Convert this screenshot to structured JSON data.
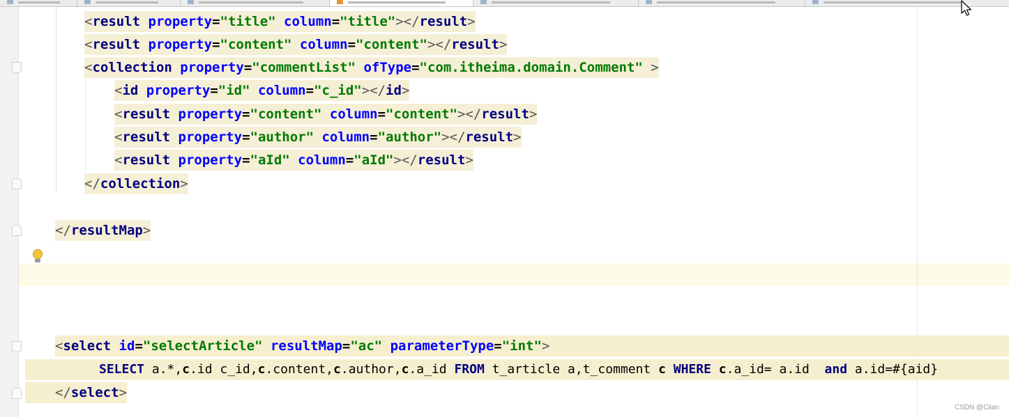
{
  "editor": {
    "tabs": [
      {
        "label": ""
      },
      {
        "label": ""
      },
      {
        "label": ""
      },
      {
        "label": "",
        "active": true
      },
      {
        "label": ""
      },
      {
        "label": ""
      },
      {
        "label": ""
      }
    ],
    "code": {
      "l1": {
        "o": "<",
        "tag": "result",
        "a1": "property",
        "v1": "\"title\"",
        "a2": "column",
        "v2": "\"title\"",
        "c": "></",
        "ct": "result",
        "e": ">"
      },
      "l2": {
        "o": "<",
        "tag": "result",
        "a1": "property",
        "v1": "\"content\"",
        "a2": "column",
        "v2": "\"content\"",
        "c": "></",
        "ct": "result",
        "e": ">"
      },
      "l3": {
        "o": "<",
        "tag": "collection",
        "a1": "property",
        "v1": "\"commentList\"",
        "a2": "ofType",
        "v2": "\"com.itheima.domain.Comment\"",
        "e": ">"
      },
      "l4": {
        "o": "<",
        "tag": "id",
        "a1": "property",
        "v1": "\"id\"",
        "a2": "column",
        "v2": "\"c_id\"",
        "c": "></",
        "ct": "id",
        "e": ">"
      },
      "l5": {
        "o": "<",
        "tag": "result",
        "a1": "property",
        "v1": "\"content\"",
        "a2": "column",
        "v2": "\"content\"",
        "c": "></",
        "ct": "result",
        "e": ">"
      },
      "l6": {
        "o": "<",
        "tag": "result",
        "a1": "property",
        "v1": "\"author\"",
        "a2": "column",
        "v2": "\"author\"",
        "c": "></",
        "ct": "result",
        "e": ">"
      },
      "l7": {
        "o": "<",
        "tag": "result",
        "a1": "property",
        "v1": "\"aId\"",
        "a2": "column",
        "v2": "\"aId\"",
        "c": "></",
        "ct": "result",
        "e": ">"
      },
      "l8": {
        "o": "</",
        "tag": "collection",
        "e": ">"
      },
      "l9": {
        "o": "</",
        "tag": "resultMap",
        "e": ">"
      },
      "l10": {
        "o": "<",
        "tag": "select",
        "a1": "id",
        "v1": "\"selectArticle\"",
        "a2": "resultMap",
        "v2": "\"ac\"",
        "a3": "parameterType",
        "v3": "\"int\"",
        "e": ">"
      },
      "l11": {
        "k1": "SELECT",
        "s1": "a.*,",
        "x1": "c",
        "s2": ".id c_id,",
        "x2": "c",
        "s3": ".content,",
        "x3": "c",
        "s4": ".author,",
        "x4": "c",
        "s5": ".a_id",
        "k2": "FROM",
        "s6": "t_article a,t_comment",
        "x5": "c",
        "k3": "WHERE",
        "x6": "c",
        "s7": ".a_id= a.id ",
        "k4": "and",
        "s8": "a.id=#{aid}"
      },
      "l12": {
        "o": "</",
        "tag": "select",
        "e": ">"
      }
    },
    "watermark": "CSDN @Ciian"
  }
}
